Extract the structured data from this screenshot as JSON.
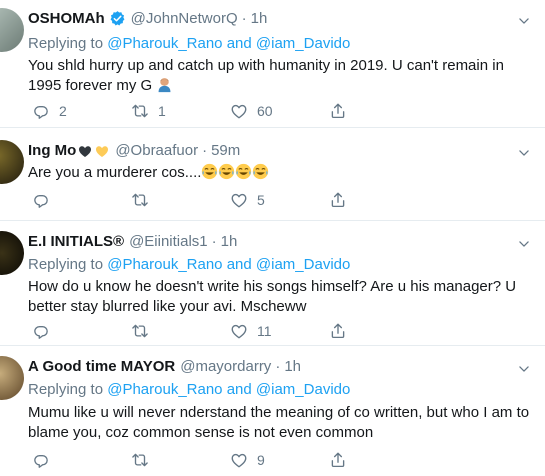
{
  "tweets": [
    {
      "name": "OSHOMAh",
      "handle": "@JohnNetworQ",
      "dot": "·",
      "time": "1h",
      "verified": true,
      "reply_prefix": "Replying to",
      "reply_mention_1": "@Pharouk_Rano",
      "reply_and": "and",
      "reply_mention_2": "@iam_Davido",
      "text_1": "You shld hurry up and catch up with humanity in 2019. U can't remain in",
      "text_2": "1995 forever my G",
      "text_emoji": "man-bowing-emoji",
      "replies": "2",
      "retweets": "1",
      "likes": "60"
    },
    {
      "name": "Ing Mo",
      "name_icons": [
        "black-heart-icon",
        "yellow-heart-icon"
      ],
      "handle": "@Obraafuor",
      "dot": "·",
      "time": "59m",
      "text_1": "Are you a murderer cos....",
      "text_emojis": [
        "tears-of-joy-emoji",
        "tears-of-joy-emoji",
        "tears-of-joy-emoji",
        "tears-of-joy-emoji"
      ],
      "replies": "",
      "retweets": "",
      "likes": "5"
    },
    {
      "name": "E.I INITIALS®",
      "handle": "@Eiinitials1",
      "dot": "·",
      "time": "1h",
      "reply_prefix": "Replying to",
      "reply_mention_1": "@Pharouk_Rano",
      "reply_and": "and",
      "reply_mention_2": "@iam_Davido",
      "text_1": "How do u know he doesn't write his songs himself? Are u his manager? U",
      "text_2": "better stay blurred like your avi. Mscheww",
      "replies": "",
      "retweets": "",
      "likes": "11"
    },
    {
      "name": "A Good time MAYOR",
      "handle": "@mayordarry",
      "dot": "·",
      "time": "1h",
      "reply_prefix": "Replying to",
      "reply_mention_1": "@Pharouk_Rano",
      "reply_and": "and",
      "reply_mention_2": "@iam_Davido",
      "text_1": "Mumu like u will never nderstand the meaning of co written, but who I am to",
      "text_2": "blame you, coz common sense is not even common",
      "replies": "",
      "retweets": "",
      "likes": "9"
    }
  ],
  "colors": {
    "accent": "#1da1f2",
    "secondary_text": "#657786",
    "divider": "#e6ecf0"
  }
}
